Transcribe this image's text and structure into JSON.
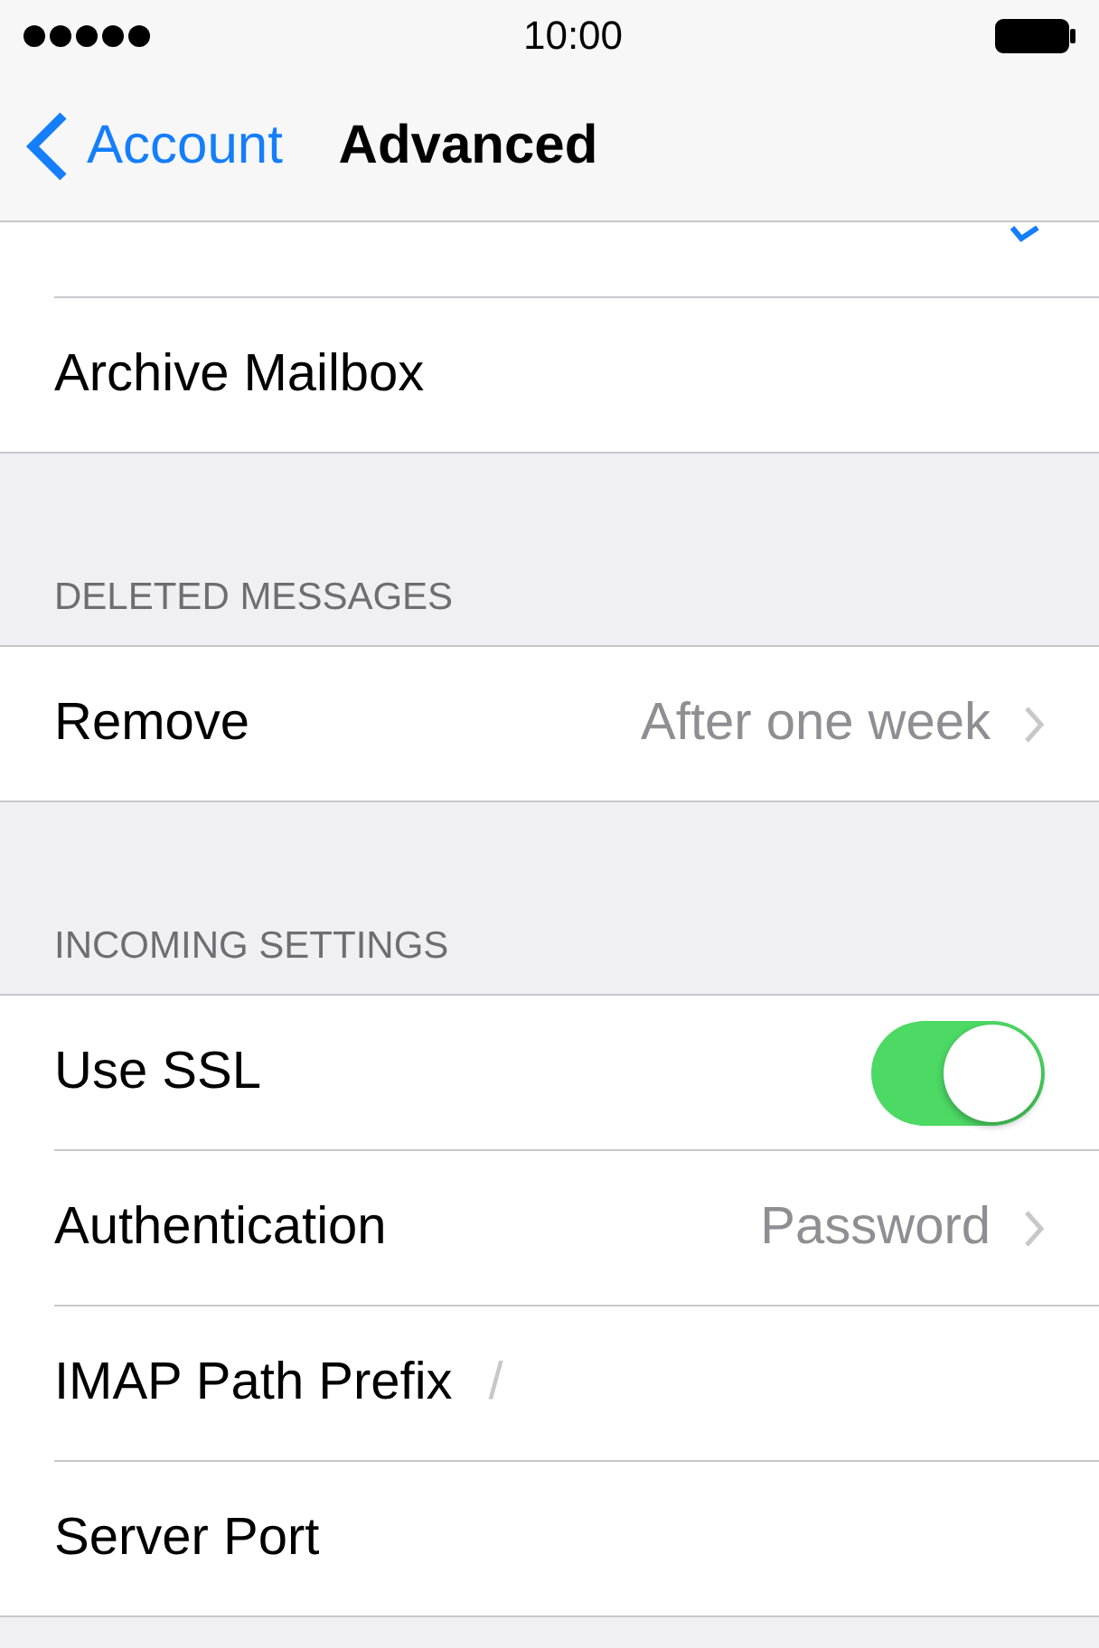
{
  "status_bar": {
    "time": "10:00"
  },
  "nav": {
    "back": "Account",
    "title": "Advanced"
  },
  "sections": [
    {
      "rows": [
        {
          "kind": "check",
          "checked": true
        },
        {
          "kind": "check",
          "label": "Archive Mailbox",
          "checked": false
        }
      ]
    },
    {
      "header": "DELETED MESSAGES",
      "rows": [
        {
          "kind": "disclosure",
          "label": "Remove",
          "value": "After one week"
        }
      ]
    },
    {
      "header": "INCOMING SETTINGS",
      "rows": [
        {
          "kind": "toggle",
          "label": "Use SSL",
          "on": true
        },
        {
          "kind": "disclosure",
          "label": "Authentication",
          "value": "Password"
        },
        {
          "kind": "field",
          "label": "IMAP Path Prefix",
          "placeholder": "/"
        },
        {
          "kind": "field",
          "label": "Server Port"
        }
      ]
    }
  ]
}
